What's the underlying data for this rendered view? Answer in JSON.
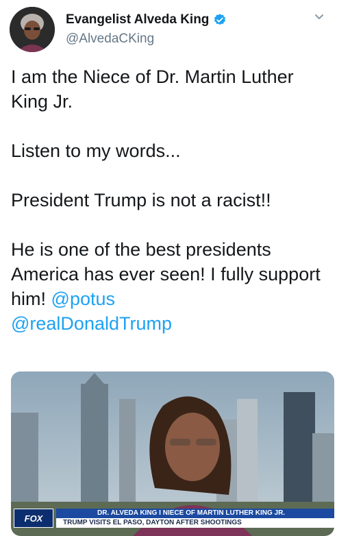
{
  "author": {
    "name": "Evangelist Alveda King",
    "handle": "@AlvedaCKing",
    "verified": true
  },
  "tweet": {
    "paragraphs": [
      "I am the Niece of Dr. Martin Luther King Jr.",
      "Listen to my words...",
      "President Trump is not a racist!!",
      "He is one of the best presidents America has ever seen! I fully support him!"
    ],
    "mentions": [
      "@potus",
      "@realDonaldTrump"
    ]
  },
  "media": {
    "logo": "FOX",
    "chyron_top": "DR. ALVEDA KING I NIECE OF MARTIN LUTHER KING JR.",
    "chyron_bottom": "TRUMP VISITS EL PASO, DAYTON AFTER SHOOTINGS"
  },
  "icons": {
    "verified": "verified-badge-icon",
    "menu": "chevron-down-icon"
  },
  "colors": {
    "link": "#1da1f2",
    "verified": "#1da1f2",
    "secondary_text": "#657786",
    "chyron_blue": "#1b4aa0"
  }
}
